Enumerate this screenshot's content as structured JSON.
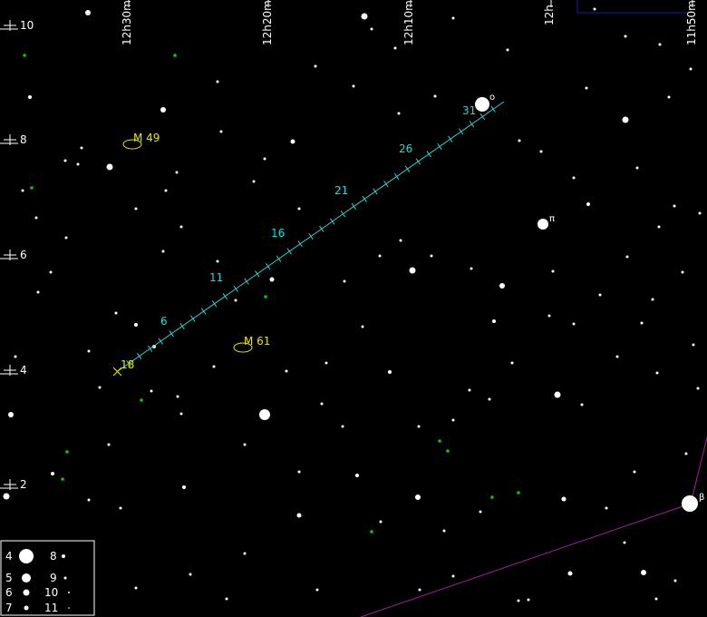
{
  "dec_labels": [
    "10",
    "8",
    "6",
    "4",
    "2"
  ],
  "ra_labels": [
    "12h30m",
    "12h20m",
    "12h10m",
    "12h",
    "11h50m"
  ],
  "track": {
    "labels": [
      "31",
      "26",
      "21",
      "16",
      "11",
      "6",
      "18"
    ],
    "line_color": "#33cccc"
  },
  "galaxies": [
    {
      "name": "M 49"
    },
    {
      "name": "M 61"
    }
  ],
  "greek": [
    "o",
    "π",
    "β"
  ],
  "legend": {
    "rows": [
      {
        "left": "4",
        "right": "8"
      },
      {
        "left": "5",
        "right": "9"
      },
      {
        "left": "6",
        "right": "10"
      },
      {
        "left": "7",
        "right": "11"
      }
    ]
  },
  "colors": {
    "background": "#000000",
    "track": "#33cccc",
    "galaxy": "#e6e600",
    "constellation": "#a020a0",
    "boundary": "#1a1aa0",
    "green_object": "#00cc00"
  }
}
